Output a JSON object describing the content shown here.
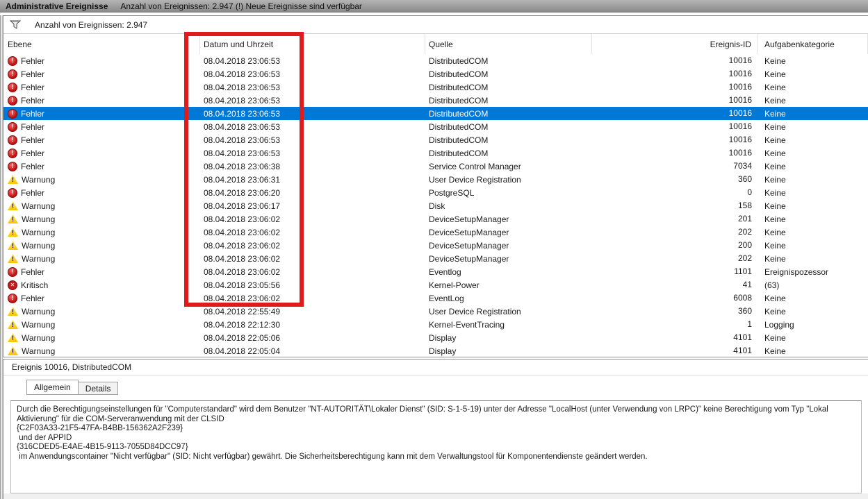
{
  "title_bar": {
    "title": "Administrative Ereignisse",
    "subtitle": "Anzahl von Ereignissen: 2.947 (!) Neue Ereignisse sind verfügbar"
  },
  "filter_bar": {
    "icon": "filter-funnel-icon",
    "label": "Anzahl von Ereignissen: 2.947"
  },
  "table": {
    "columns": [
      "Ebene",
      "Datum und Uhrzeit",
      "Quelle",
      "Ereignis-ID",
      "Aufgabenkategorie"
    ],
    "rows": [
      {
        "type": "error",
        "level": "Fehler",
        "date": "08.04.2018 23:06:53",
        "source": "DistributedCOM",
        "id": "10016",
        "category": "Keine",
        "selected": false
      },
      {
        "type": "error",
        "level": "Fehler",
        "date": "08.04.2018 23:06:53",
        "source": "DistributedCOM",
        "id": "10016",
        "category": "Keine",
        "selected": false
      },
      {
        "type": "error",
        "level": "Fehler",
        "date": "08.04.2018 23:06:53",
        "source": "DistributedCOM",
        "id": "10016",
        "category": "Keine",
        "selected": false
      },
      {
        "type": "error",
        "level": "Fehler",
        "date": "08.04.2018 23:06:53",
        "source": "DistributedCOM",
        "id": "10016",
        "category": "Keine",
        "selected": false
      },
      {
        "type": "error",
        "level": "Fehler",
        "date": "08.04.2018 23:06:53",
        "source": "DistributedCOM",
        "id": "10016",
        "category": "Keine",
        "selected": true
      },
      {
        "type": "error",
        "level": "Fehler",
        "date": "08.04.2018 23:06:53",
        "source": "DistributedCOM",
        "id": "10016",
        "category": "Keine",
        "selected": false
      },
      {
        "type": "error",
        "level": "Fehler",
        "date": "08.04.2018 23:06:53",
        "source": "DistributedCOM",
        "id": "10016",
        "category": "Keine",
        "selected": false
      },
      {
        "type": "error",
        "level": "Fehler",
        "date": "08.04.2018 23:06:53",
        "source": "DistributedCOM",
        "id": "10016",
        "category": "Keine",
        "selected": false
      },
      {
        "type": "error",
        "level": "Fehler",
        "date": "08.04.2018 23:06:38",
        "source": "Service Control Manager",
        "id": "7034",
        "category": "Keine",
        "selected": false
      },
      {
        "type": "warning",
        "level": "Warnung",
        "date": "08.04.2018 23:06:31",
        "source": "User Device Registration",
        "id": "360",
        "category": "Keine",
        "selected": false
      },
      {
        "type": "error",
        "level": "Fehler",
        "date": "08.04.2018 23:06:20",
        "source": "PostgreSQL",
        "id": "0",
        "category": "Keine",
        "selected": false
      },
      {
        "type": "warning",
        "level": "Warnung",
        "date": "08.04.2018 23:06:17",
        "source": "Disk",
        "id": "158",
        "category": "Keine",
        "selected": false
      },
      {
        "type": "warning",
        "level": "Warnung",
        "date": "08.04.2018 23:06:02",
        "source": "DeviceSetupManager",
        "id": "201",
        "category": "Keine",
        "selected": false
      },
      {
        "type": "warning",
        "level": "Warnung",
        "date": "08.04.2018 23:06:02",
        "source": "DeviceSetupManager",
        "id": "202",
        "category": "Keine",
        "selected": false
      },
      {
        "type": "warning",
        "level": "Warnung",
        "date": "08.04.2018 23:06:02",
        "source": "DeviceSetupManager",
        "id": "200",
        "category": "Keine",
        "selected": false
      },
      {
        "type": "warning",
        "level": "Warnung",
        "date": "08.04.2018 23:06:02",
        "source": "DeviceSetupManager",
        "id": "202",
        "category": "Keine",
        "selected": false
      },
      {
        "type": "error",
        "level": "Fehler",
        "date": "08.04.2018 23:06:02",
        "source": "Eventlog",
        "id": "1101",
        "category": "Ereignispozessor",
        "selected": false
      },
      {
        "type": "critical",
        "level": "Kritisch",
        "date": "08.04.2018 23:05:56",
        "source": "Kernel-Power",
        "id": "41",
        "category": "(63)",
        "selected": false
      },
      {
        "type": "error",
        "level": "Fehler",
        "date": "08.04.2018 23:06:02",
        "source": "EventLog",
        "id": "6008",
        "category": "Keine",
        "selected": false
      },
      {
        "type": "warning",
        "level": "Warnung",
        "date": "08.04.2018 22:55:49",
        "source": "User Device Registration",
        "id": "360",
        "category": "Keine",
        "selected": false
      },
      {
        "type": "warning",
        "level": "Warnung",
        "date": "08.04.2018 22:12:30",
        "source": "Kernel-EventTracing",
        "id": "1",
        "category": "Logging",
        "selected": false
      },
      {
        "type": "warning",
        "level": "Warnung",
        "date": "08.04.2018 22:05:06",
        "source": "Display",
        "id": "4101",
        "category": "Keine",
        "selected": false
      },
      {
        "type": "warning",
        "level": "Warnung",
        "date": "08.04.2018 22:05:04",
        "source": "Display",
        "id": "4101",
        "category": "Keine",
        "selected": false
      }
    ]
  },
  "preview": {
    "header": "Ereignis 10016, DistributedCOM",
    "tabs": [
      {
        "label": "Allgemein",
        "active": true
      },
      {
        "label": "Details",
        "active": false
      }
    ],
    "body_lines": [
      "Durch die Berechtigungseinstellungen für \"Computerstandard\" wird dem Benutzer \"NT-AUTORITÄT\\Lokaler Dienst\" (SID: S-1-5-19) unter der Adresse \"LocalHost (unter Verwendung von LRPC)\" keine Berechtigung vom Typ \"Lokal",
      "Aktivierung\" für die COM-Serveranwendung mit der CLSID",
      "{C2F03A33-21F5-47FA-B4BB-156362A2F239}",
      " und der APPID",
      "{316CDED5-E4AE-4B15-9113-7055D84DCC97}",
      " im Anwendungscontainer \"Nicht verfügbar\" (SID: Nicht verfügbar) gewährt. Die Sicherheitsberechtigung kann mit dem Verwaltungstool für Komponentendienste geändert werden."
    ]
  },
  "annotation": {
    "note": "red rectangle highlighting the Datum und Uhrzeit column"
  },
  "colors": {
    "selection": "#0078d7",
    "error_icon": "#c40d0d",
    "warning_icon": "#fdc500",
    "critical_icon": "#c21b1b",
    "annotation": "#e01b1b"
  }
}
